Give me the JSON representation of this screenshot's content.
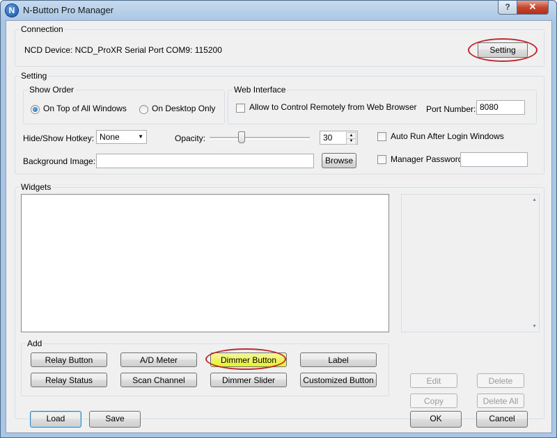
{
  "window": {
    "title": "N-Button Pro Manager",
    "icon_letter": "N",
    "help_label": "?",
    "close_label": "✕"
  },
  "connection": {
    "label": "Connection",
    "device_text": "NCD Device: NCD_ProXR  Serial Port  COM9: 115200",
    "setting_button": "Setting"
  },
  "setting": {
    "label": "Setting",
    "show_order": {
      "label": "Show Order",
      "option_top": "On Top of All Windows",
      "option_desktop": "On Desktop Only",
      "selected": "top"
    },
    "web_interface": {
      "label": "Web Interface",
      "allow_remote": "Allow to Control Remotely from Web Browser",
      "port_label": "Port Number:",
      "port_value": "8080"
    },
    "hotkey_label": "Hide/Show Hotkey:",
    "hotkey_value": "None",
    "opacity_label": "Opacity:",
    "opacity_value": "30",
    "auto_run": "Auto Run After Login Windows",
    "background_label": "Background Image:",
    "background_value": "",
    "browse_button": "Browse",
    "manager_password": "Manager Password",
    "password_value": ""
  },
  "widgets": {
    "label": "Widgets",
    "add_label": "Add",
    "buttons_row1": [
      "Relay Button",
      "A/D Meter",
      "Dimmer Button",
      "Label"
    ],
    "buttons_row2": [
      "Relay Status",
      "Scan Channel",
      "Dimmer Slider",
      "Customized Button"
    ],
    "edit": "Edit",
    "delete": "Delete",
    "copy": "Copy",
    "delete_all": "Delete All"
  },
  "footer": {
    "load": "Load",
    "save": "Save",
    "ok": "OK",
    "cancel": "Cancel"
  },
  "colors": {
    "highlight_red": "#c0282c",
    "highlight_yellow": "#e8f22a",
    "title_bar": "#a9c6e4"
  }
}
